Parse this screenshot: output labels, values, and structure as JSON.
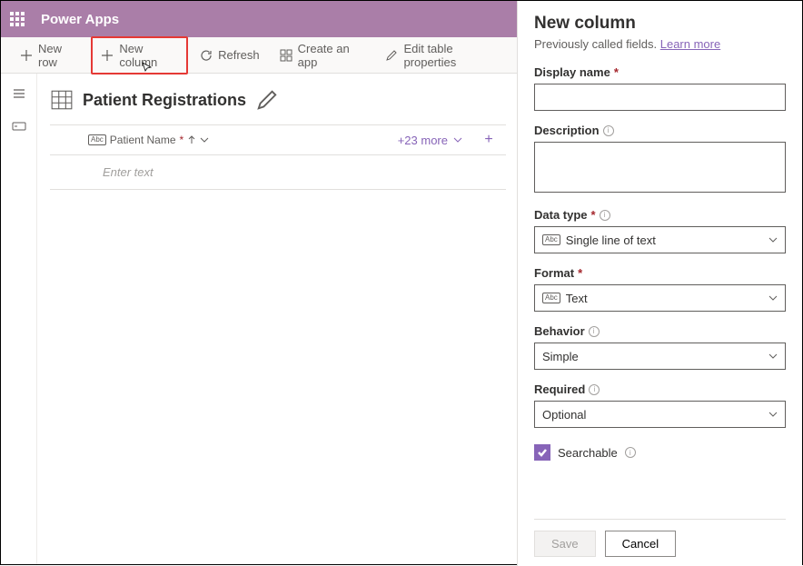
{
  "app": {
    "name": "Power Apps"
  },
  "toolbar": {
    "new_row": "New row",
    "new_column": "New column",
    "refresh": "Refresh",
    "create_app": "Create an app",
    "edit_props": "Edit table properties"
  },
  "table": {
    "title": "Patient Registrations",
    "column": {
      "name": "Patient Name",
      "required_mark": "*"
    },
    "more_label": "+23 more",
    "placeholder": "Enter text"
  },
  "panel": {
    "title": "New column",
    "subtitle_prefix": "Previously called fields. ",
    "learn_more": "Learn more",
    "labels": {
      "display_name": "Display name",
      "description": "Description",
      "data_type": "Data type",
      "format": "Format",
      "behavior": "Behavior",
      "required": "Required",
      "searchable": "Searchable"
    },
    "values": {
      "data_type": "Single line of text",
      "format": "Text",
      "behavior": "Simple",
      "required": "Optional",
      "searchable_checked": true
    },
    "buttons": {
      "save": "Save",
      "cancel": "Cancel"
    }
  }
}
